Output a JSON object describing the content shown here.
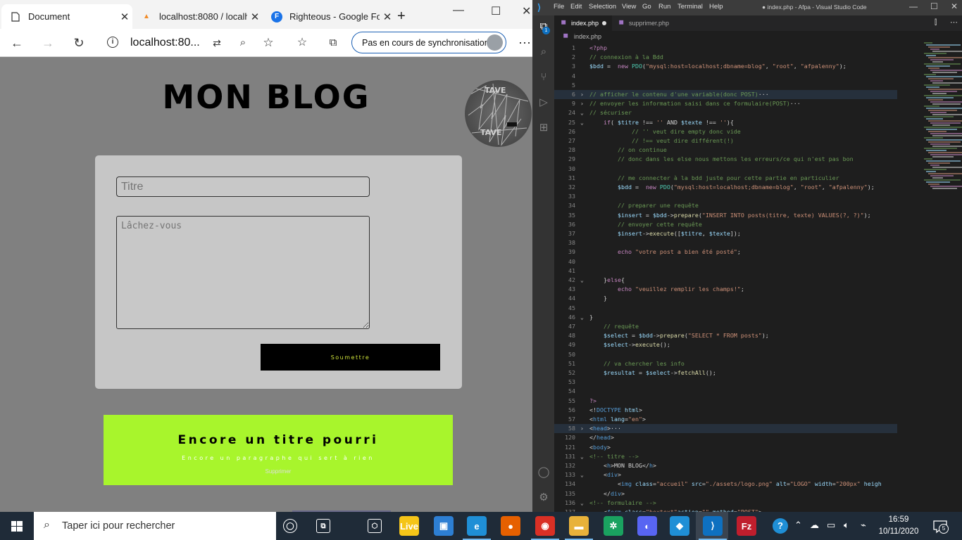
{
  "browser": {
    "tabs": [
      {
        "label": "Document",
        "icon": "page-icon"
      },
      {
        "label": "localhost:8080 / localh",
        "icon": "phpmyadmin-icon"
      },
      {
        "label": "Righteous - Google Fo",
        "icon": "google-fonts-icon"
      }
    ],
    "new_tab": "+",
    "address": "localhost:80...",
    "sync_label": "Pas en cours de synchronisation",
    "page": {
      "blog_title": "MON BLOG",
      "logo_alt": "LOGO",
      "titre_placeholder": "Titre",
      "texte_placeholder": "Lâchez-vous",
      "submit_label": "Soumettre",
      "post": {
        "title": "Encore un titre pourri",
        "text": "Encore un paragraphe qui sert à rien",
        "delete_label": "Supprimer"
      }
    }
  },
  "vscode": {
    "menu": [
      "File",
      "Edit",
      "Selection",
      "View",
      "Go",
      "Run",
      "Terminal",
      "Help"
    ],
    "window_title": "● index.php - Afpa - Visual Studio Code",
    "activity_badge": "1",
    "tabs": [
      {
        "label": "index.php",
        "modified": true
      },
      {
        "label": "supprimer.php",
        "modified": false
      }
    ],
    "breadcrumb": "index.php",
    "lines": [
      {
        "n": "1",
        "fold": "",
        "hl": false,
        "tokens": [
          [
            "kw",
            "<?php"
          ]
        ]
      },
      {
        "n": "2",
        "fold": "",
        "hl": false,
        "tokens": [
          [
            "cm",
            "// connexion à la Bdd"
          ]
        ]
      },
      {
        "n": "3",
        "fold": "",
        "hl": false,
        "tokens": [
          [
            "vr",
            "$bdd"
          ],
          [
            "pl",
            " =  "
          ],
          [
            "kw",
            "new "
          ],
          [
            "ty",
            "PDO"
          ],
          [
            "pl",
            "("
          ],
          [
            "st",
            "\"mysql:host=localhost;dbname=blog\""
          ],
          [
            "pl",
            ", "
          ],
          [
            "st",
            "\"root\""
          ],
          [
            "pl",
            ", "
          ],
          [
            "st",
            "\"afpalenny\""
          ],
          [
            "pl",
            ");"
          ]
        ]
      },
      {
        "n": "4",
        "fold": "",
        "hl": false,
        "tokens": []
      },
      {
        "n": "5",
        "fold": "",
        "hl": false,
        "tokens": []
      },
      {
        "n": "6",
        "fold": "›",
        "hl": true,
        "tokens": [
          [
            "cm",
            "// afficher le contenu d'une variable(donc POST)"
          ],
          [
            "pl",
            "···"
          ]
        ]
      },
      {
        "n": "9",
        "fold": "›",
        "hl": false,
        "tokens": [
          [
            "cm",
            "// envoyer les information saisi dans ce formulaire(POST)"
          ],
          [
            "pl",
            "···"
          ]
        ]
      },
      {
        "n": "24",
        "fold": "⌄",
        "hl": false,
        "tokens": [
          [
            "cm",
            "// sécuriser"
          ]
        ]
      },
      {
        "n": "25",
        "fold": "⌄",
        "hl": false,
        "tokens": [
          [
            "pl",
            "    "
          ],
          [
            "kw",
            "if"
          ],
          [
            "pl",
            "( "
          ],
          [
            "vr",
            "$titre"
          ],
          [
            "pl",
            " !== "
          ],
          [
            "st",
            "''"
          ],
          [
            "pl",
            " AND "
          ],
          [
            "vr",
            "$texte"
          ],
          [
            "pl",
            " !== "
          ],
          [
            "st",
            "''"
          ],
          [
            "pl",
            "){"
          ]
        ]
      },
      {
        "n": "26",
        "fold": "",
        "hl": false,
        "tokens": [
          [
            "pl",
            "            "
          ],
          [
            "cm",
            "// '' veut dire empty donc vide"
          ]
        ]
      },
      {
        "n": "27",
        "fold": "",
        "hl": false,
        "tokens": [
          [
            "pl",
            "            "
          ],
          [
            "cm",
            "// !== veut dire différent(!)"
          ]
        ]
      },
      {
        "n": "28",
        "fold": "",
        "hl": false,
        "tokens": [
          [
            "pl",
            "        "
          ],
          [
            "cm",
            "// on continue"
          ]
        ]
      },
      {
        "n": "29",
        "fold": "",
        "hl": false,
        "tokens": [
          [
            "pl",
            "        "
          ],
          [
            "cm",
            "// donc dans les else nous mettons les erreurs/ce qui n'est pas bon"
          ]
        ]
      },
      {
        "n": "30",
        "fold": "",
        "hl": false,
        "tokens": []
      },
      {
        "n": "31",
        "fold": "",
        "hl": false,
        "tokens": [
          [
            "pl",
            "        "
          ],
          [
            "cm",
            "// me connecter à la bdd juste pour cette partie en particulier"
          ]
        ]
      },
      {
        "n": "32",
        "fold": "",
        "hl": false,
        "tokens": [
          [
            "pl",
            "        "
          ],
          [
            "vr",
            "$bdd"
          ],
          [
            "pl",
            " =  "
          ],
          [
            "kw",
            "new "
          ],
          [
            "ty",
            "PDO"
          ],
          [
            "pl",
            "("
          ],
          [
            "st",
            "\"mysql:host=localhost;dbname=blog\""
          ],
          [
            "pl",
            ", "
          ],
          [
            "st",
            "\"root\""
          ],
          [
            "pl",
            ", "
          ],
          [
            "st",
            "\"afpalenny\""
          ],
          [
            "pl",
            ");"
          ]
        ]
      },
      {
        "n": "33",
        "fold": "",
        "hl": false,
        "tokens": []
      },
      {
        "n": "34",
        "fold": "",
        "hl": false,
        "tokens": [
          [
            "pl",
            "        "
          ],
          [
            "cm",
            "// preparer une requête"
          ]
        ]
      },
      {
        "n": "35",
        "fold": "",
        "hl": false,
        "tokens": [
          [
            "pl",
            "        "
          ],
          [
            "vr",
            "$insert"
          ],
          [
            "pl",
            " = "
          ],
          [
            "vr",
            "$bdd"
          ],
          [
            "pl",
            "->"
          ],
          [
            "fn",
            "prepare"
          ],
          [
            "pl",
            "("
          ],
          [
            "st",
            "\"INSERT INTO posts(titre, texte) VALUES(?, ?)\""
          ],
          [
            "pl",
            ");"
          ]
        ]
      },
      {
        "n": "36",
        "fold": "",
        "hl": false,
        "tokens": [
          [
            "pl",
            "        "
          ],
          [
            "cm",
            "// envoyer cette requête"
          ]
        ]
      },
      {
        "n": "37",
        "fold": "",
        "hl": false,
        "tokens": [
          [
            "pl",
            "        "
          ],
          [
            "vr",
            "$insert"
          ],
          [
            "pl",
            "->"
          ],
          [
            "fn",
            "execute"
          ],
          [
            "pl",
            "(["
          ],
          [
            "vr",
            "$titre"
          ],
          [
            "pl",
            ", "
          ],
          [
            "vr",
            "$texte"
          ],
          [
            "pl",
            "]);"
          ]
        ]
      },
      {
        "n": "38",
        "fold": "",
        "hl": false,
        "tokens": []
      },
      {
        "n": "39",
        "fold": "",
        "hl": false,
        "tokens": [
          [
            "pl",
            "        "
          ],
          [
            "kw",
            "echo "
          ],
          [
            "st",
            "\"votre post a bien été posté\""
          ],
          [
            "pl",
            ";"
          ]
        ]
      },
      {
        "n": "40",
        "fold": "",
        "hl": false,
        "tokens": []
      },
      {
        "n": "41",
        "fold": "",
        "hl": false,
        "tokens": []
      },
      {
        "n": "42",
        "fold": "⌄",
        "hl": false,
        "tokens": [
          [
            "pl",
            "    }"
          ],
          [
            "kw",
            "else"
          ],
          [
            "pl",
            "{"
          ]
        ]
      },
      {
        "n": "43",
        "fold": "",
        "hl": false,
        "tokens": [
          [
            "pl",
            "        "
          ],
          [
            "kw",
            "echo "
          ],
          [
            "st",
            "\"veuillez remplir les champs!\""
          ],
          [
            "pl",
            ";"
          ]
        ]
      },
      {
        "n": "44",
        "fold": "",
        "hl": false,
        "tokens": [
          [
            "pl",
            "    }"
          ]
        ]
      },
      {
        "n": "45",
        "fold": "",
        "hl": false,
        "tokens": []
      },
      {
        "n": "46",
        "fold": "⌄",
        "hl": false,
        "tokens": [
          [
            "pl",
            "}"
          ]
        ]
      },
      {
        "n": "47",
        "fold": "",
        "hl": false,
        "tokens": [
          [
            "pl",
            "    "
          ],
          [
            "cm",
            "// requête"
          ]
        ]
      },
      {
        "n": "48",
        "fold": "",
        "hl": false,
        "tokens": [
          [
            "pl",
            "    "
          ],
          [
            "vr",
            "$select"
          ],
          [
            "pl",
            " = "
          ],
          [
            "vr",
            "$bdd"
          ],
          [
            "pl",
            "->"
          ],
          [
            "fn",
            "prepare"
          ],
          [
            "pl",
            "("
          ],
          [
            "st",
            "\"SELECT * FROM posts\""
          ],
          [
            "pl",
            ");"
          ]
        ]
      },
      {
        "n": "49",
        "fold": "",
        "hl": false,
        "tokens": [
          [
            "pl",
            "    "
          ],
          [
            "vr",
            "$select"
          ],
          [
            "pl",
            "->"
          ],
          [
            "fn",
            "execute"
          ],
          [
            "pl",
            "();"
          ]
        ]
      },
      {
        "n": "50",
        "fold": "",
        "hl": false,
        "tokens": []
      },
      {
        "n": "51",
        "fold": "",
        "hl": false,
        "tokens": [
          [
            "pl",
            "    "
          ],
          [
            "cm",
            "// va chercher les info"
          ]
        ]
      },
      {
        "n": "52",
        "fold": "",
        "hl": false,
        "tokens": [
          [
            "pl",
            "    "
          ],
          [
            "vr",
            "$resultat"
          ],
          [
            "pl",
            " = "
          ],
          [
            "vr",
            "$select"
          ],
          [
            "pl",
            "->"
          ],
          [
            "fn",
            "fetchAll"
          ],
          [
            "pl",
            "();"
          ]
        ]
      },
      {
        "n": "53",
        "fold": "",
        "hl": false,
        "tokens": []
      },
      {
        "n": "54",
        "fold": "",
        "hl": false,
        "tokens": []
      },
      {
        "n": "55",
        "fold": "",
        "hl": false,
        "tokens": [
          [
            "kw",
            "?>"
          ]
        ]
      },
      {
        "n": "56",
        "fold": "",
        "hl": false,
        "tokens": [
          [
            "pl",
            "<!"
          ],
          [
            "tg",
            "DOCTYPE "
          ],
          [
            "at",
            "html"
          ],
          [
            "pl",
            ">"
          ]
        ]
      },
      {
        "n": "57",
        "fold": "",
        "hl": false,
        "tokens": [
          [
            "pl",
            "<"
          ],
          [
            "tg",
            "html "
          ],
          [
            "at",
            "lang"
          ],
          [
            "pl",
            "="
          ],
          [
            "st",
            "\"en\""
          ],
          [
            "pl",
            ">"
          ]
        ]
      },
      {
        "n": "58",
        "fold": "›",
        "hl": true,
        "tokens": [
          [
            "pl",
            "<"
          ],
          [
            "tg",
            "head"
          ],
          [
            "pl",
            ">···"
          ]
        ]
      },
      {
        "n": "120",
        "fold": "",
        "hl": false,
        "tokens": [
          [
            "pl",
            "</"
          ],
          [
            "tg",
            "head"
          ],
          [
            "pl",
            ">"
          ]
        ]
      },
      {
        "n": "121",
        "fold": "",
        "hl": false,
        "tokens": [
          [
            "pl",
            "<"
          ],
          [
            "tg",
            "body"
          ],
          [
            "pl",
            ">"
          ]
        ]
      },
      {
        "n": "131",
        "fold": "⌄",
        "hl": false,
        "tokens": [
          [
            "cm",
            "<!-- titre -->"
          ]
        ]
      },
      {
        "n": "132",
        "fold": "",
        "hl": false,
        "tokens": [
          [
            "pl",
            "    <"
          ],
          [
            "tg",
            "h"
          ],
          [
            "pl",
            ">MON BLOG</"
          ],
          [
            "tg",
            "h"
          ],
          [
            "pl",
            ">"
          ]
        ]
      },
      {
        "n": "133",
        "fold": "⌄",
        "hl": false,
        "tokens": [
          [
            "pl",
            "    <"
          ],
          [
            "tg",
            "div"
          ],
          [
            "pl",
            ">"
          ]
        ]
      },
      {
        "n": "134",
        "fold": "",
        "hl": false,
        "tokens": [
          [
            "pl",
            "        <"
          ],
          [
            "tg",
            "img "
          ],
          [
            "at",
            "class"
          ],
          [
            "pl",
            "="
          ],
          [
            "st",
            "\"accueil\""
          ],
          [
            "pl",
            " "
          ],
          [
            "at",
            "src"
          ],
          [
            "pl",
            "="
          ],
          [
            "st",
            "\"./assets/logo.png\""
          ],
          [
            "pl",
            " "
          ],
          [
            "at",
            "alt"
          ],
          [
            "pl",
            "="
          ],
          [
            "st",
            "\"LOGO\""
          ],
          [
            "pl",
            " "
          ],
          [
            "at",
            "width"
          ],
          [
            "pl",
            "="
          ],
          [
            "st",
            "\"200px\""
          ],
          [
            "pl",
            " "
          ],
          [
            "at",
            "heigh"
          ]
        ]
      },
      {
        "n": "135",
        "fold": "",
        "hl": false,
        "tokens": [
          [
            "pl",
            "    </"
          ],
          [
            "tg",
            "div"
          ],
          [
            "pl",
            ">"
          ]
        ]
      },
      {
        "n": "136",
        "fold": "⌄",
        "hl": false,
        "tokens": [
          [
            "cm",
            "<!-- formulaire -->"
          ]
        ]
      },
      {
        "n": "137",
        "fold": "",
        "hl": false,
        "tokens": [
          [
            "pl",
            "    <"
          ],
          [
            "tg",
            "form "
          ],
          [
            "at",
            "class"
          ],
          [
            "pl",
            "="
          ],
          [
            "st",
            "\"boxtext\""
          ],
          [
            "at",
            "action"
          ],
          [
            "pl",
            "="
          ],
          [
            "st",
            "\"\""
          ],
          [
            "pl",
            " "
          ],
          [
            "at",
            "method"
          ],
          [
            "pl",
            "="
          ],
          [
            "st",
            "\"POST\""
          ],
          [
            "pl",
            ">"
          ]
        ]
      }
    ]
  },
  "taskbar": {
    "search_placeholder": "Taper ici pour rechercher",
    "apps": [
      {
        "name": "task-view-icon",
        "color": "#1f2b38",
        "glyph": "◯"
      },
      {
        "name": "timeline-icon",
        "color": "#1f2b38",
        "glyph": "⧉"
      },
      {
        "name": "cube-app-icon",
        "color": "#1f2b38",
        "glyph": "⬡"
      },
      {
        "name": "live-app-icon",
        "color": "#f5c518",
        "glyph": "Live"
      },
      {
        "name": "photos-icon",
        "color": "#2d7fd3",
        "glyph": "▣"
      },
      {
        "name": "edge-icon",
        "color": "#1f8fd6",
        "glyph": "e"
      },
      {
        "name": "firefox-icon",
        "color": "#e66000",
        "glyph": "●"
      },
      {
        "name": "chrome-icon",
        "color": "#d93025",
        "glyph": "◉"
      },
      {
        "name": "file-explorer-icon",
        "color": "#e8b23a",
        "glyph": "▬"
      },
      {
        "name": "settings-gear-icon",
        "color": "#1aa260",
        "glyph": "✲"
      },
      {
        "name": "discord-icon",
        "color": "#5865f2",
        "glyph": "◐"
      },
      {
        "name": "globe-app-icon",
        "color": "#1f8fd6",
        "glyph": "◆"
      },
      {
        "name": "vscode-icon",
        "color": "#0e70c0",
        "glyph": "⟩"
      },
      {
        "name": "filezilla-icon",
        "color": "#bf1e2d",
        "glyph": "Fz"
      }
    ],
    "time": "16:59",
    "date": "10/11/2020",
    "notification_count": "5"
  }
}
